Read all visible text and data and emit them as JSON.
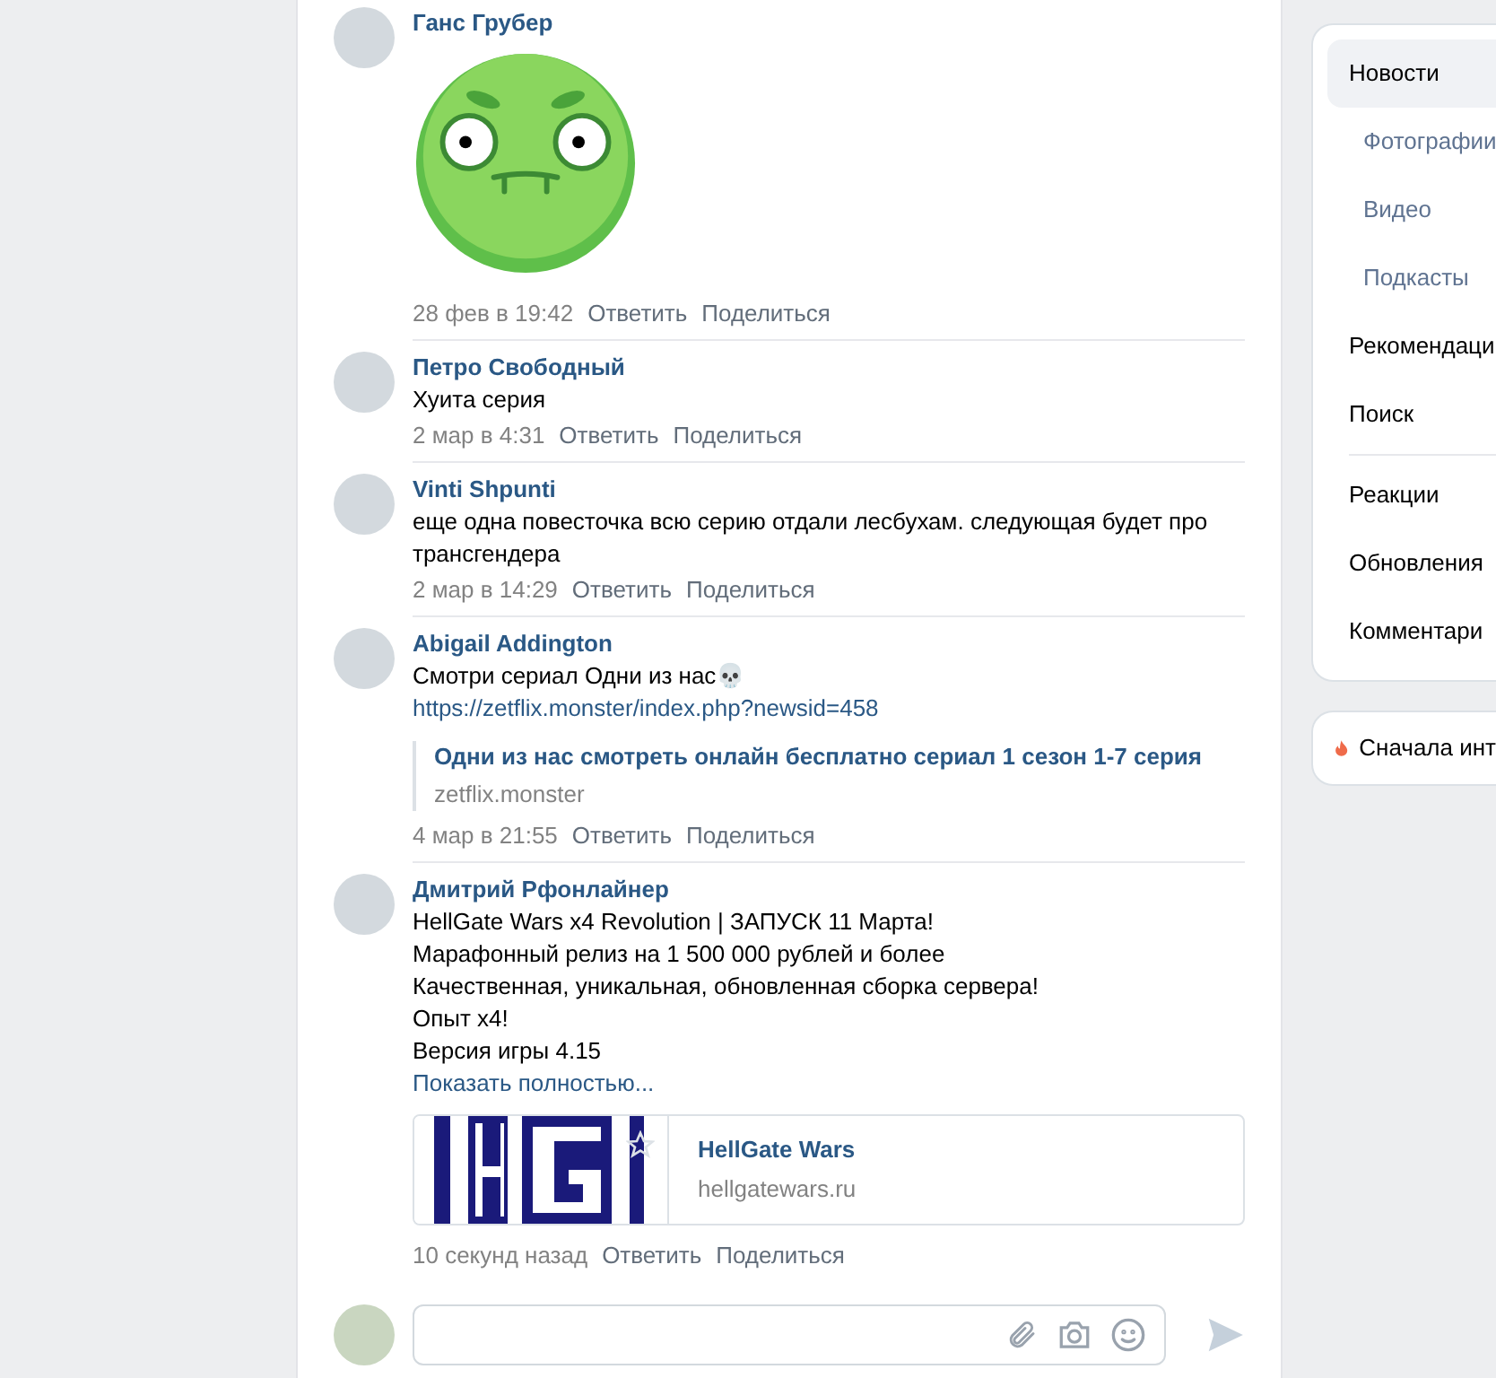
{
  "comments": [
    {
      "author": "Ганс Грубер",
      "attachment": {
        "kind": "sticker"
      },
      "time": "28 фев в 19:42",
      "reply": "Ответить",
      "share": "Поделиться"
    },
    {
      "author": "Петро Свободный",
      "lines": [
        "Хуита серия"
      ],
      "time": "2 мар в 4:31",
      "reply": "Ответить",
      "share": "Поделиться"
    },
    {
      "author": "Vinti Shpunti",
      "lines": [
        "еще одна повесточка всю серию отдали лесбухам. следующая будет про трансгендера"
      ],
      "time": "2 мар в 14:29",
      "reply": "Ответить",
      "share": "Поделиться"
    },
    {
      "author": "Abigail Addington",
      "lines": [
        "Смотри сериал Одни из нас💀"
      ],
      "url": "https://zetflix.monster/index.php?newsid=458",
      "attachment": {
        "kind": "snippet",
        "title": "Одни из нас смотреть онлайн бесплатно сериал 1 сезон 1-7 серия",
        "domain": "zetflix.monster"
      },
      "time": "4 мар в 21:55",
      "reply": "Ответить",
      "share": "Поделиться"
    },
    {
      "author": "Дмитрий Рфонлайнер",
      "lines": [
        "HellGate Wars x4 Revolution | ЗАПУСК 11 Марта!",
        "Марафонный релиз на 1 500 000 рублей и более",
        "Качественная, уникальная, обновленная сборка сервера!",
        "Опыт x4!",
        "Версия игры 4.15"
      ],
      "show_more": "Показать полностью...",
      "attachment": {
        "kind": "link_card",
        "title": "HellGate Wars",
        "domain": "hellgatewars.ru"
      },
      "time": "10 секунд назад",
      "reply": "Ответить",
      "share": "Поделиться"
    }
  ],
  "menu": {
    "items": [
      {
        "label": "Новости",
        "kind": "main",
        "selected": true
      },
      {
        "label": "Фотографии",
        "kind": "sub",
        "selected": false
      },
      {
        "label": "Видео",
        "kind": "sub",
        "selected": false
      },
      {
        "label": "Подкасты",
        "kind": "sub",
        "selected": false
      },
      {
        "label": "Рекомендаци",
        "kind": "main",
        "selected": false
      },
      {
        "label": "Поиск",
        "kind": "main",
        "selected": false
      },
      {
        "label": "Реакции",
        "kind": "main",
        "selected": false,
        "divider_before": true
      },
      {
        "label": "Обновления",
        "kind": "main",
        "selected": false
      },
      {
        "label": "Комментари",
        "kind": "main",
        "selected": false
      }
    ]
  },
  "sort": {
    "label": "Сначала инт"
  }
}
